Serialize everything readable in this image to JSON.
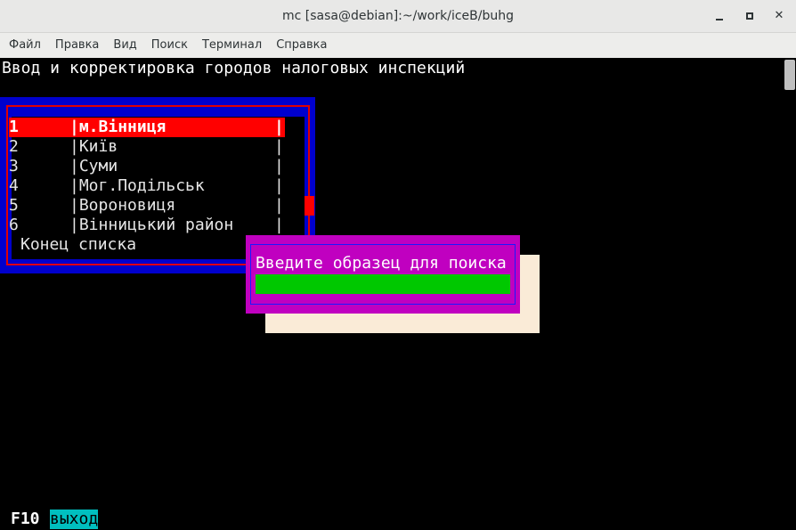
{
  "window": {
    "title": "mc [sasa@debian]:~/work/iceB/buhg"
  },
  "menu": [
    "Файл",
    "Правка",
    "Вид",
    "Поиск",
    "Терминал",
    "Справка"
  ],
  "terminal": {
    "heading": "Ввод и корректировка городов налоговых инспекций",
    "list": {
      "rows": [
        {
          "num": "1",
          "name": "м.Вінниця",
          "selected": true
        },
        {
          "num": "2",
          "name": "Київ"
        },
        {
          "num": "3",
          "name": "Суми"
        },
        {
          "num": "4",
          "name": "Мог.Подільськ"
        },
        {
          "num": "5",
          "name": "Вороновиця"
        },
        {
          "num": "6",
          "name": "Вінницький район"
        }
      ],
      "separator": "|",
      "end_label": "Конец списка"
    },
    "search_dialog": {
      "prompt": "Введите образец для поиска",
      "value": ""
    },
    "keys": {
      "f10": "F10",
      "exit_label": "выход"
    }
  },
  "colors": {
    "list_border": "#0000cd",
    "list_frame": "#e00000",
    "selection": "#ff0000",
    "dialog_bg": "#c000c0",
    "input_bg": "#00c800",
    "shadow": "#faebd7",
    "exit_bg": "#00bfbf"
  }
}
